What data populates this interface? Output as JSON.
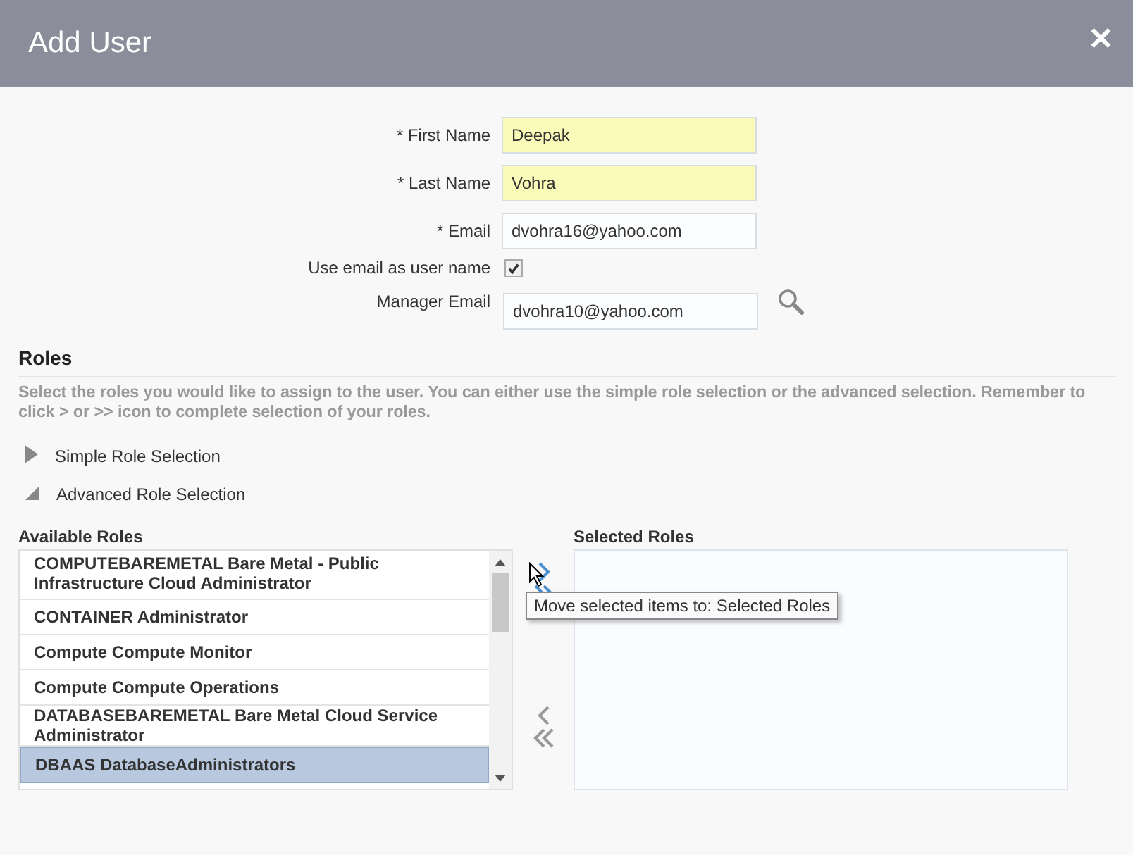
{
  "dialog": {
    "title": "Add User",
    "close": "✕"
  },
  "form": [
    {
      "kind": "text",
      "label": "* First Name",
      "value": "Deepak",
      "highlighted": true
    },
    {
      "kind": "text",
      "label": "* Last Name",
      "value": "Vohra",
      "highlighted": true
    },
    {
      "kind": "text",
      "label": "* Email",
      "value": "dvohra16@yahoo.com",
      "highlighted": false
    },
    {
      "kind": "checkbox",
      "label": "Use email as user name",
      "checked": true
    },
    {
      "kind": "search",
      "label": "Manager Email",
      "value": "dvohra10@yahoo.com",
      "highlighted": false
    }
  ],
  "roles": {
    "heading": "Roles",
    "description": "Select the roles you would like to assign to the user. You can either use the simple role selection or the advanced selection. Remember to click > or >> icon to complete selection of your roles.",
    "sections": [
      {
        "label": "Simple Role Selection",
        "expanded": false
      },
      {
        "label": "Advanced Role Selection",
        "expanded": true
      }
    ],
    "available_label": "Available Roles",
    "selected_label": "Selected Roles",
    "available": [
      {
        "label": "COMPUTEBAREMETAL Bare Metal - Public Infrastructure Cloud Administrator",
        "selected": false
      },
      {
        "label": "CONTAINER Administrator",
        "selected": false
      },
      {
        "label": "Compute Compute Monitor",
        "selected": false
      },
      {
        "label": "Compute Compute Operations",
        "selected": false
      },
      {
        "label": "DATABASEBAREMETAL Bare Metal Cloud Service Administrator",
        "selected": false
      },
      {
        "label": "DBAAS DatabaseAdministrators",
        "selected": true
      }
    ],
    "tooltip": "Move selected items to: Selected Roles"
  }
}
